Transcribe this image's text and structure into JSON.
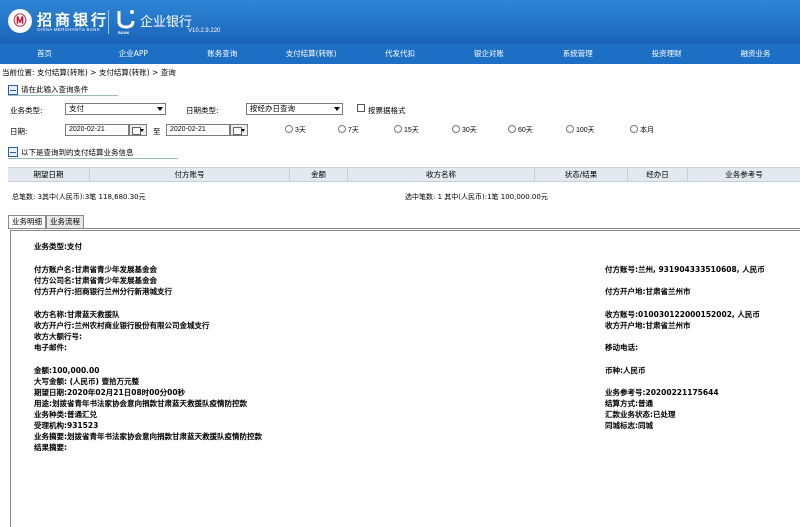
{
  "header": {
    "logo_char": "Ⓜ",
    "bank_name": "招商银行",
    "bank_name_en": "CHINA MERCHANTS BANK",
    "mark_en": "BANK",
    "corp_bank": "企业银行",
    "version": "V10.2.9.220"
  },
  "nav": [
    "首页",
    "企业APP",
    "账务查询",
    "支付结算(转账)",
    "代发代扣",
    "银企对账",
    "系统管理",
    "投资理财",
    "融资业务"
  ],
  "breadcrumb": "当前位置: 支付结算(转账) > 支付结算(转账) > 查询",
  "query": {
    "title": "请在此输入查询条件",
    "biz_type_label": "业务类型:",
    "biz_type_value": "支付",
    "date_type_label": "日期类型:",
    "date_type_value": "按经办日查询",
    "ticket_format_label": "按票据格式",
    "date_label": "日期:",
    "date_from": "2020-02-21",
    "to_label": "至",
    "date_to": "2020-02-21",
    "ranges": [
      "3天",
      "7天",
      "15天",
      "30天",
      "60天",
      "100天",
      "本月"
    ]
  },
  "result": {
    "title": "以下是查询到的支付结算业务信息",
    "columns": [
      "期望日期",
      "付方账号",
      "金额",
      "收方名称",
      "状态/结果",
      "经办日",
      "业务参考号"
    ],
    "summary_left": "总笔数: 3其中(人民币):3笔  118,680.30元",
    "summary_right": "选中笔数: 1 其中(人民币):1笔  100,000.00元"
  },
  "tabs": [
    "业务明细",
    "业务流程"
  ],
  "detail": {
    "biz_type": "业务类型:支付",
    "payer_name": "付方账户名:甘肃省青少年发展基金会",
    "payer_company": "付方公司名:甘肃省青少年发展基金会",
    "payer_bank": "付方开户行:招商银行兰州分行新港城支行",
    "payer_account": "付方账号:兰州, 931904333510608, 人民币",
    "payer_bank_location": "付方开户地:甘肃省兰州市",
    "payee_name": "收方名称:甘肃蓝天救援队",
    "payee_bank": "收方开户行:兰州农村商业银行股份有限公司金城支行",
    "payee_large_bank_no": "收方大额行号:",
    "email": "电子邮件:",
    "payee_account": "收方账号:010030122000152002, 人民币",
    "payee_bank_location": "收方开户地:甘肃省兰州市",
    "mobile": "移动电话:",
    "amount": "金额:100,000.00",
    "amount_upper": "大写金额: (人民币) 壹拾万元整",
    "expect_date": "期望日期:2020年02月21日08时00分00秒",
    "purpose": "用途:划拨省青年书法家协会意向捐款甘肃蓝天救援队疫情防控款",
    "biz_kind": "业务种类:普通汇兑",
    "handling_org": "受理机构:931523",
    "biz_summary": "业务摘要:划拨省青年书法家协会意向捐款甘肃蓝天救援队疫情防控款",
    "result_summary": "结果摘要:",
    "currency": "币种:人民币",
    "ref_no": "业务参考号:20200221175644",
    "settle_method": "结算方式:普通",
    "remit_status": "汇款业务状态:已处理",
    "same_city": "同城标志:同城"
  }
}
